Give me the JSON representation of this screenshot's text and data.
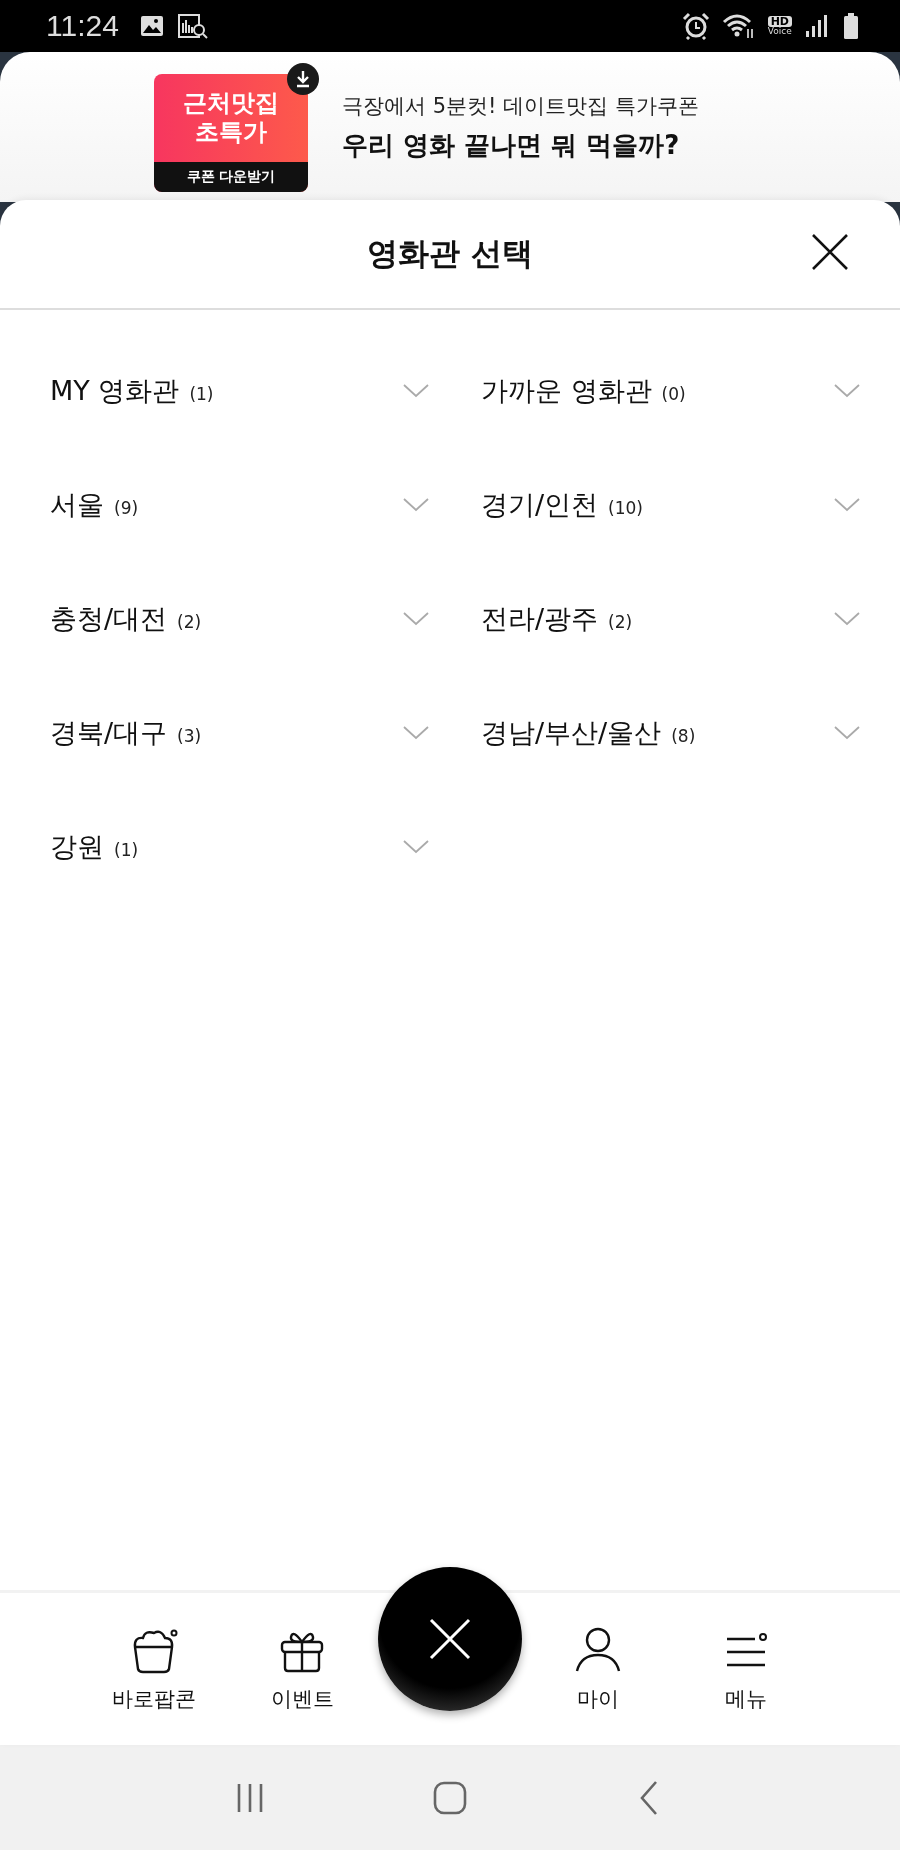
{
  "status_bar": {
    "time": "11:24",
    "hd_label": "HD",
    "voice_label": "Voice"
  },
  "banner": {
    "badge_title": "근처맛집\n초특가",
    "badge_button": "쿠폰 다운받기",
    "subtitle": "극장에서 5분컷! 데이트맛집 특가쿠폰",
    "title": "우리 영화 끝나면 뭐 먹을까?"
  },
  "sheet": {
    "title": "영화관 선택"
  },
  "regions": [
    {
      "name": "MY 영화관",
      "count": "(1)",
      "expanded": false
    },
    {
      "name": "가까운 영화관",
      "count": "(0)",
      "expanded": false
    },
    {
      "name": "서울",
      "count": "(9)",
      "expanded": false
    },
    {
      "name": "경기/인천",
      "count": "(10)",
      "expanded": false
    },
    {
      "name": "충청/대전",
      "count": "(2)",
      "expanded": false
    },
    {
      "name": "전라/광주",
      "count": "(2)",
      "expanded": false
    },
    {
      "name": "경북/대구",
      "count": "(3)",
      "expanded": false
    },
    {
      "name": "경남/부산/울산",
      "count": "(8)",
      "expanded": false
    },
    {
      "name": "강원",
      "count": "(1)",
      "expanded": false
    }
  ],
  "bottom_nav": [
    {
      "kind": "popcorn",
      "label": "바로팝콘"
    },
    {
      "kind": "gift",
      "label": "이벤트"
    },
    {
      "kind": "close"
    },
    {
      "kind": "person",
      "label": "마이"
    },
    {
      "kind": "menu",
      "label": "메뉴"
    }
  ]
}
